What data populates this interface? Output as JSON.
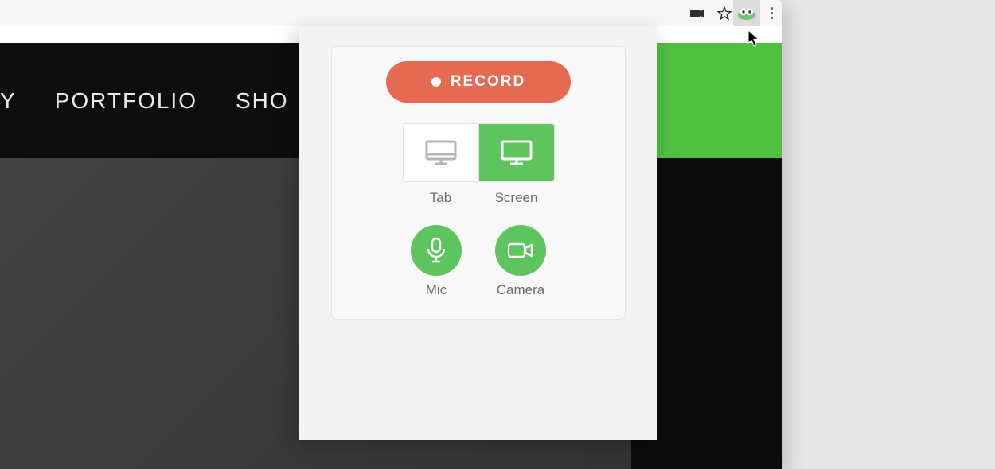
{
  "nav": {
    "items": [
      "Y",
      "PORTFOLIO",
      "SHO"
    ]
  },
  "popup": {
    "record_label": "RECORD",
    "source": {
      "tab_label": "Tab",
      "screen_label": "Screen"
    },
    "toggles": {
      "mic_label": "Mic",
      "camera_label": "Camera"
    }
  },
  "colors": {
    "accent_green": "#5ec55e",
    "record_red": "#e56a52"
  }
}
